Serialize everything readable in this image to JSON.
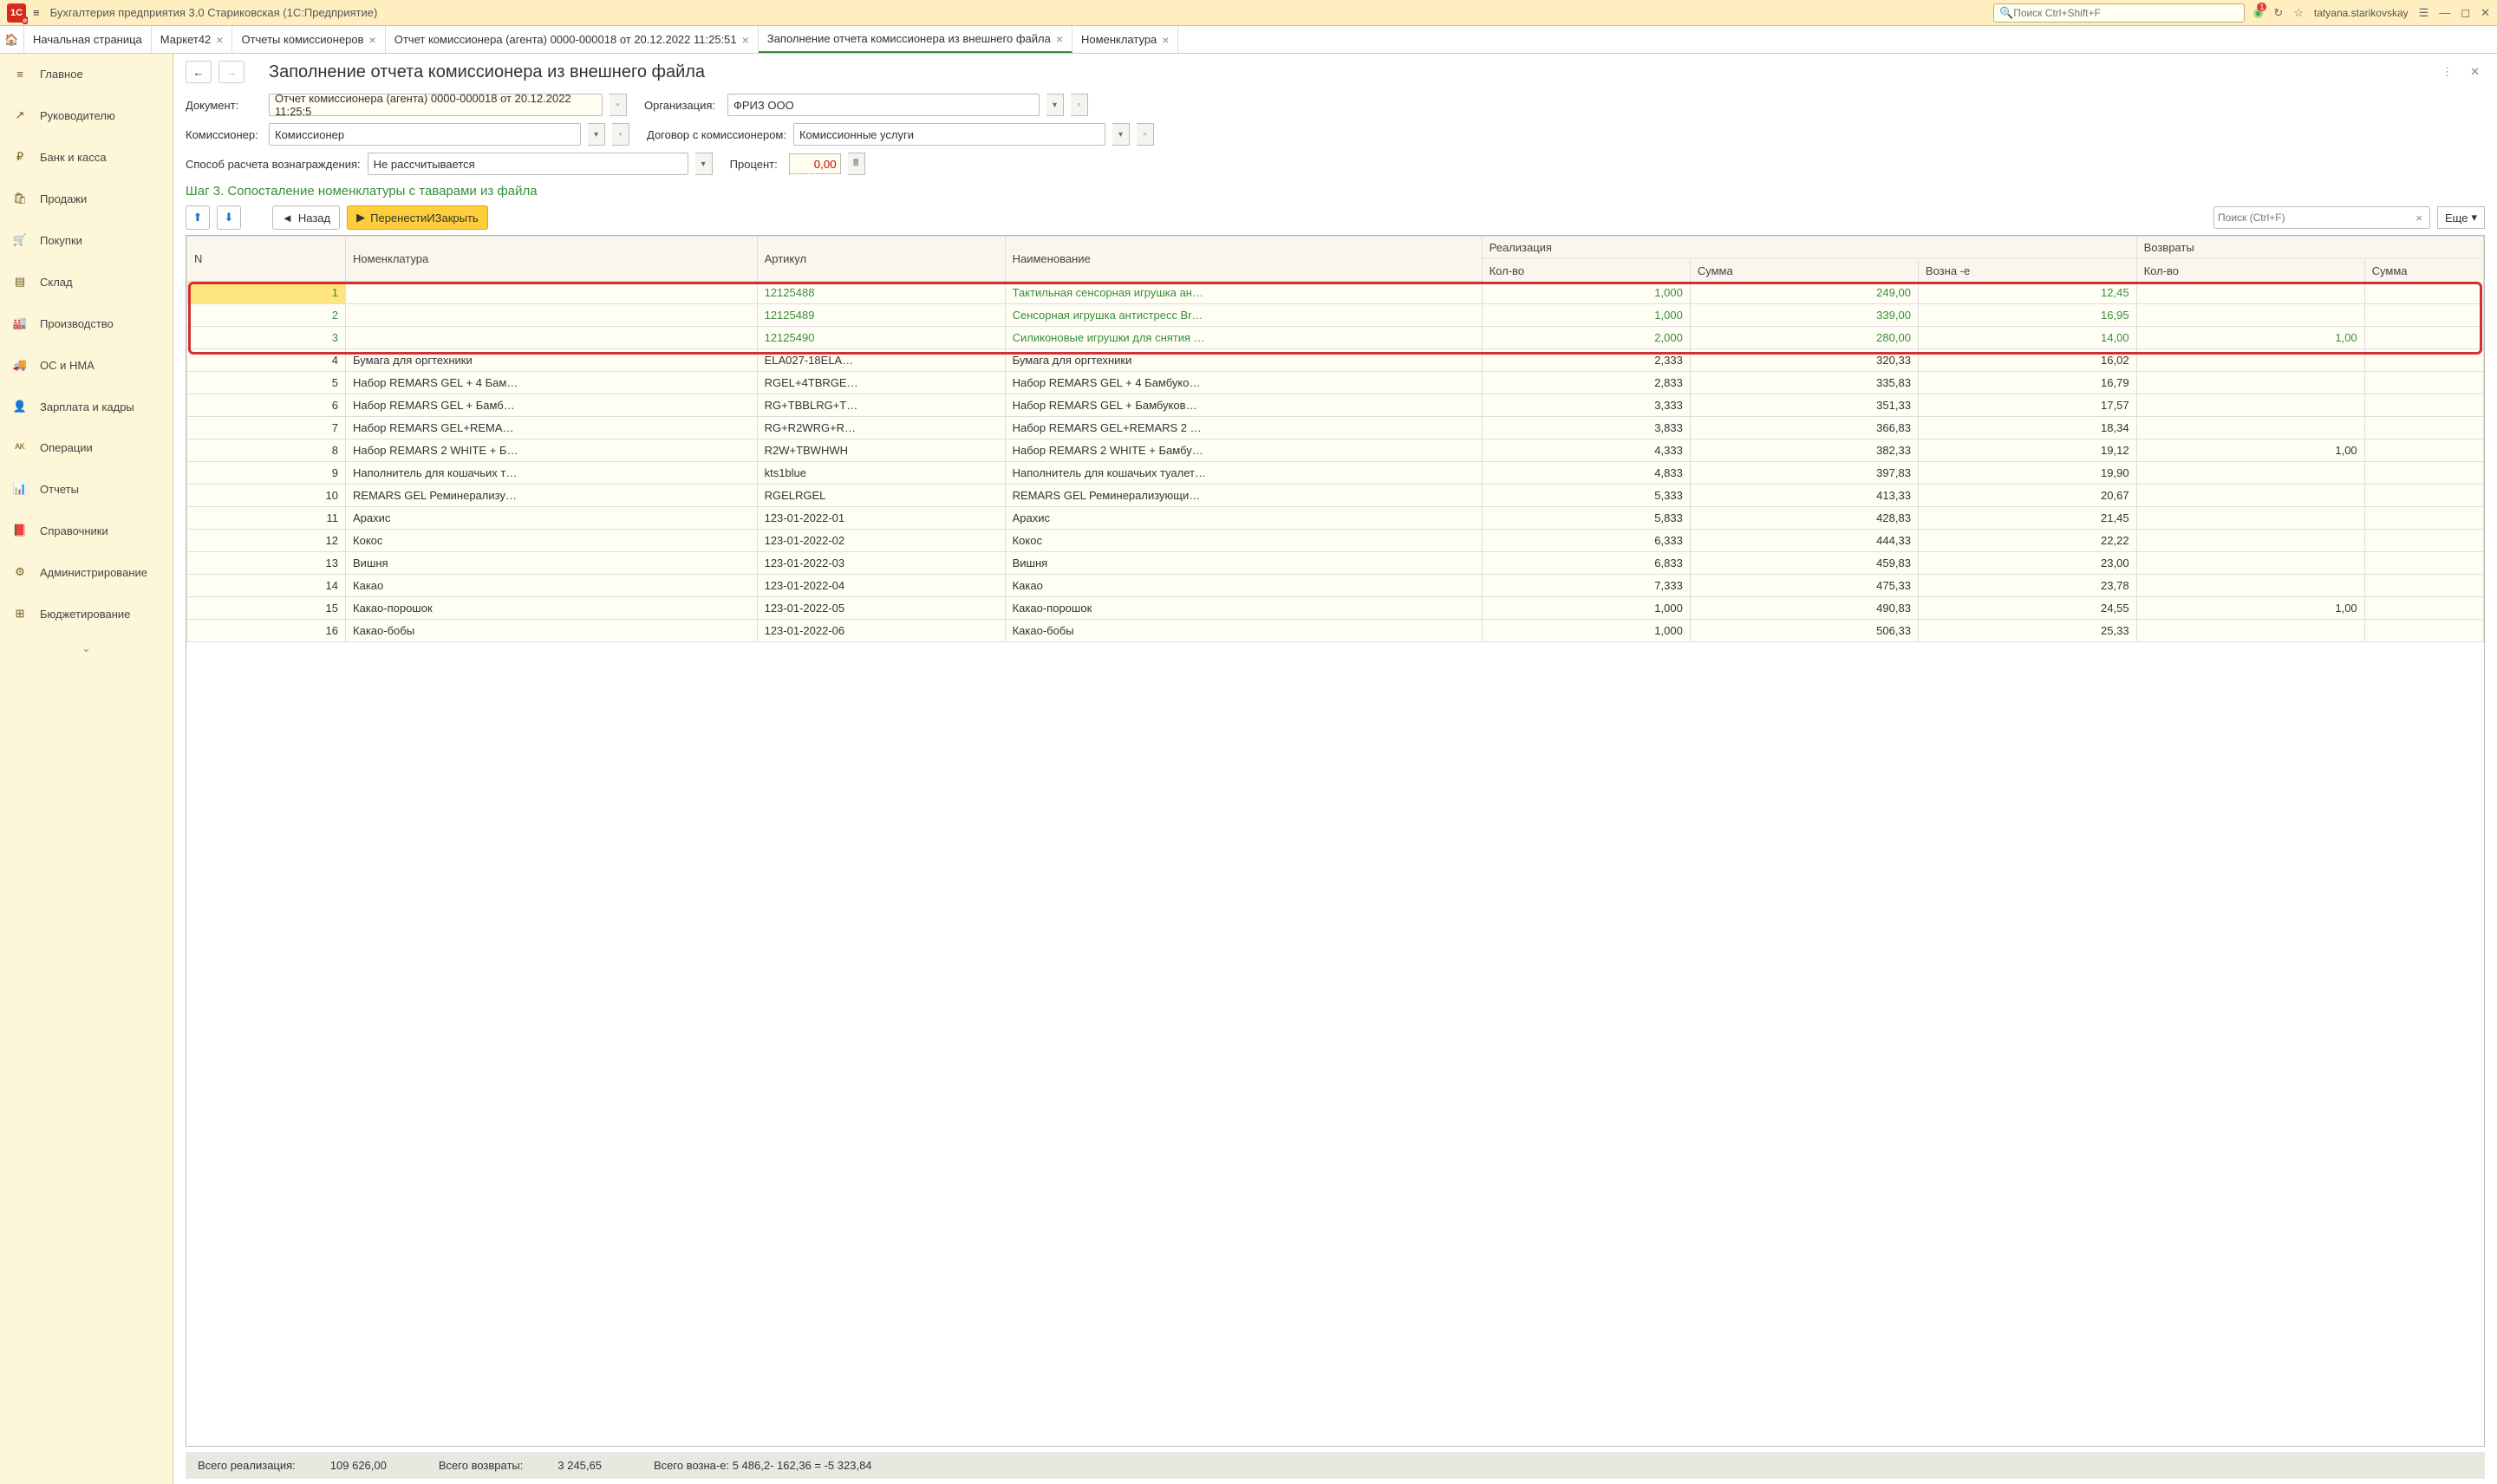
{
  "titlebar": {
    "app_title": "Бухгалтерия предприятия 3.0 Стариковская  (1С:Предприятие)",
    "search_placeholder": "Поиск Ctrl+Shift+F",
    "username": "tatyana.starikovskay",
    "notif_count": "1"
  },
  "tabs": [
    {
      "label": "Начальная страница",
      "closable": false
    },
    {
      "label": "Маркет42",
      "closable": true
    },
    {
      "label": "Отчеты комиссионеров",
      "closable": true
    },
    {
      "label": "Отчет комиссионера (агента) 0000-000018 от 20.12.2022 11:25:51",
      "closable": true
    },
    {
      "label": "Заполнение  отчета комиссионера из внешнего  файла",
      "closable": true,
      "active": true
    },
    {
      "label": "Номенклатура",
      "closable": true
    }
  ],
  "sidebar": [
    {
      "icon": "≡",
      "label": "Главное"
    },
    {
      "icon": "↗",
      "label": "Руководителю"
    },
    {
      "icon": "₽",
      "label": "Банк и касса"
    },
    {
      "icon": "🛍",
      "label": "Продажи"
    },
    {
      "icon": "🛒",
      "label": "Покупки"
    },
    {
      "icon": "▤",
      "label": "Склад"
    },
    {
      "icon": "🏭",
      "label": "Производство"
    },
    {
      "icon": "🚚",
      "label": "ОС и НМА"
    },
    {
      "icon": "👤",
      "label": "Зарплата и кадры"
    },
    {
      "icon": "ᴬᴷ",
      "label": "Операции"
    },
    {
      "icon": "📊",
      "label": "Отчеты"
    },
    {
      "icon": "📕",
      "label": "Справочники"
    },
    {
      "icon": "⚙",
      "label": "Администрирование"
    },
    {
      "icon": "⊞",
      "label": "Бюджетирование"
    }
  ],
  "page": {
    "title": "Заполнение  отчета комиссионера из внешнего  файла",
    "labels": {
      "document": "Документ:",
      "organization": "Организация:",
      "commissioner": "Комиссионер:",
      "contract": "Договор с комиссионером:",
      "calc_method": "Способ расчета вознаграждения:",
      "percent": "Процент:"
    },
    "values": {
      "document": "Отчет комиссионера (агента) 0000-000018 от 20.12.2022 11:25:5",
      "organization": "ФРИЗ ООО",
      "commissioner": "Комиссионер",
      "contract": "Комиссионные услуги",
      "calc_method": "Не рассчитывается",
      "percent": "0,00"
    },
    "step_title": "Шаг 3. Сопосталение номенклатуры с таварами из файла",
    "buttons": {
      "back": "Назад",
      "transfer": "ПеренестиИЗакрыть",
      "more": "Еще"
    },
    "filter_placeholder": "Поиск (Ctrl+F)"
  },
  "table": {
    "headers": {
      "n": "N",
      "nomenclature": "Номенклатура",
      "article": "Артикул",
      "name": "Наименование",
      "realization": "Реализация",
      "returns": "Возвраты",
      "qty": "Кол-во",
      "sum": "Сумма",
      "fee": "Возна -е"
    },
    "rows": [
      {
        "n": "1",
        "nom": "",
        "art": "12125488",
        "name": "Тактильная сенсорная игрушка ан…",
        "qty": "1,000",
        "sum": "249,00",
        "fee": "12,45",
        "rqty": "",
        "green": true,
        "selected": true
      },
      {
        "n": "2",
        "nom": "",
        "art": "12125489",
        "name": "Сенсорная игрушка антистресс Br…",
        "qty": "1,000",
        "sum": "339,00",
        "fee": "16,95",
        "rqty": "",
        "green": true
      },
      {
        "n": "3",
        "nom": "",
        "art": "12125490",
        "name": "Силиконовые игрушки для снятия …",
        "qty": "2,000",
        "sum": "280,00",
        "fee": "14,00",
        "rqty": "1,00",
        "green": true
      },
      {
        "n": "4",
        "nom": "Бумага для оргтехники",
        "art": "ELA027-18ELA…",
        "name": "Бумага для оргтехники",
        "qty": "2,333",
        "sum": "320,33",
        "fee": "16,02",
        "rqty": ""
      },
      {
        "n": "5",
        "nom": "Набор REMARS GEL + 4 Бам…",
        "art": "RGEL+4TBRGE…",
        "name": "Набор REMARS GEL + 4 Бамбуко…",
        "qty": "2,833",
        "sum": "335,83",
        "fee": "16,79",
        "rqty": ""
      },
      {
        "n": "6",
        "nom": "Набор REMARS GEL + Бамб…",
        "art": "RG+TBBLRG+T…",
        "name": "Набор REMARS GEL + Бамбуков…",
        "qty": "3,333",
        "sum": "351,33",
        "fee": "17,57",
        "rqty": ""
      },
      {
        "n": "7",
        "nom": "Набор REMARS GEL+REMA…",
        "art": "RG+R2WRG+R…",
        "name": "Набор REMARS GEL+REMARS 2 …",
        "qty": "3,833",
        "sum": "366,83",
        "fee": "18,34",
        "rqty": ""
      },
      {
        "n": "8",
        "nom": "Набор REMARS 2 WHITE + Б…",
        "art": "R2W+TBWHWH",
        "name": "Набор REMARS 2 WHITE + Бамбу…",
        "qty": "4,333",
        "sum": "382,33",
        "fee": "19,12",
        "rqty": "1,00"
      },
      {
        "n": "9",
        "nom": "Наполнитель для кошачьих т…",
        "art": "kts1blue",
        "name": "Наполнитель для кошачьих туалет…",
        "qty": "4,833",
        "sum": "397,83",
        "fee": "19,90",
        "rqty": ""
      },
      {
        "n": "10",
        "nom": "REMARS GEL Реминерализу…",
        "art": "RGELRGEL",
        "name": "REMARS GEL Реминерализующи…",
        "qty": "5,333",
        "sum": "413,33",
        "fee": "20,67",
        "rqty": ""
      },
      {
        "n": "11",
        "nom": "Арахис",
        "art": "123-01-2022-01",
        "name": "Арахис",
        "qty": "5,833",
        "sum": "428,83",
        "fee": "21,45",
        "rqty": ""
      },
      {
        "n": "12",
        "nom": "Кокос",
        "art": "123-01-2022-02",
        "name": "Кокос",
        "qty": "6,333",
        "sum": "444,33",
        "fee": "22,22",
        "rqty": ""
      },
      {
        "n": "13",
        "nom": "Вишня",
        "art": "123-01-2022-03",
        "name": "Вишня",
        "qty": "6,833",
        "sum": "459,83",
        "fee": "23,00",
        "rqty": ""
      },
      {
        "n": "14",
        "nom": "Какао",
        "art": "123-01-2022-04",
        "name": "Какао",
        "qty": "7,333",
        "sum": "475,33",
        "fee": "23,78",
        "rqty": ""
      },
      {
        "n": "15",
        "nom": "Какао-порошок",
        "art": "123-01-2022-05",
        "name": "Какао-порошок",
        "qty": "1,000",
        "sum": "490,83",
        "fee": "24,55",
        "rqty": "1,00"
      },
      {
        "n": "16",
        "nom": "Какао-бобы",
        "art": "123-01-2022-06",
        "name": "Какао-бобы",
        "qty": "1,000",
        "sum": "506,33",
        "fee": "25,33",
        "rqty": ""
      }
    ]
  },
  "footer": {
    "total_real_label": "Всего реализация:",
    "total_real": "109 626,00",
    "total_ret_label": "Всего возвраты:",
    "total_ret": "3 245,65",
    "total_fee_label": "Всего возна-е:",
    "total_fee": "5 486,2- 162,36 = -5 323,84"
  }
}
